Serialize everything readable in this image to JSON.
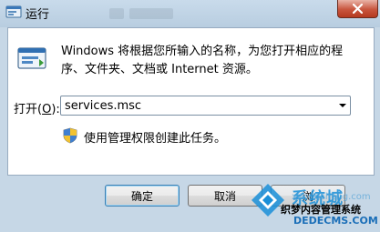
{
  "window": {
    "title": "运行",
    "close_glyph": "✕"
  },
  "dialog": {
    "description": "Windows 将根据您所输入的名称，为您打开相应的程序、文件夹、文档或 Internet 资源。",
    "open_label_prefix": "打开(",
    "open_label_mnemonic": "O",
    "open_label_suffix": "):",
    "open_value": "services.msc",
    "admin_note": "使用管理权限创建此任务。"
  },
  "buttons": {
    "ok": "确定",
    "cancel": "取消",
    "browse": "浏"
  },
  "watermark": {
    "brand": "系统城",
    "domain": "xitongcheng.com",
    "cn_text": "织梦内容管理系统",
    "dede": "DEDECMS.COM"
  },
  "colors": {
    "accent_blue": "#1a8fd8",
    "close_red": "#c8553d"
  },
  "icons": [
    "run-icon",
    "shield-icon",
    "close-icon",
    "dropdown-arrow-icon"
  ]
}
